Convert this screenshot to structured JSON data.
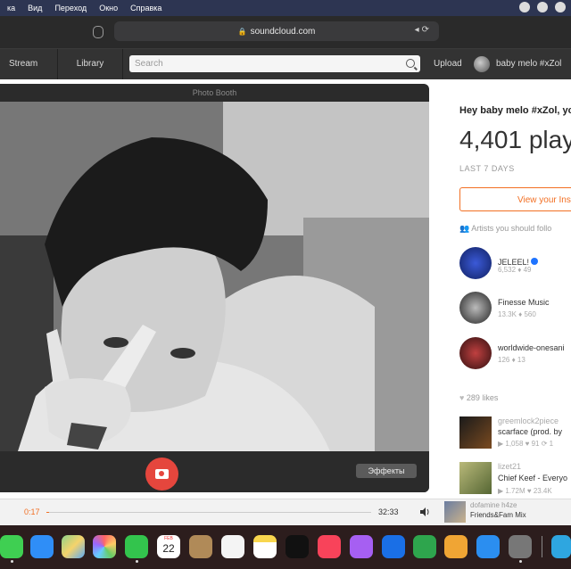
{
  "menubar": {
    "items": [
      "ка",
      "Вид",
      "Переход",
      "Окно",
      "Справка"
    ]
  },
  "browser": {
    "url": "soundcloud.com"
  },
  "soundcloud": {
    "nav": {
      "stream": "Stream",
      "library": "Library"
    },
    "search_placeholder": "Search",
    "upload": "Upload",
    "username": "baby melo #xZol"
  },
  "photo_booth": {
    "title": "Photo Booth",
    "effects_label": "Эффекты"
  },
  "sidebar": {
    "greeting": "Hey baby melo #xZol, yo",
    "plays": "4,401 play",
    "period": "LAST 7 DAYS",
    "insights_button": "View your Ins",
    "artists_title": "Artists you should follo",
    "artists": [
      {
        "name": "JELEEL!",
        "followers": "6,532",
        "tracks": "49",
        "verified": true
      },
      {
        "name": "Finesse Music",
        "followers": "13.3K",
        "tracks": "560",
        "verified": false
      },
      {
        "name": "worldwide-onesani",
        "followers": "126",
        "tracks": "13",
        "verified": false
      }
    ],
    "likes": "289 likes",
    "liked_tracks": [
      {
        "user": "greemlock2piece",
        "title": "scarface (prod. by",
        "plays": "1,058",
        "likes": "91",
        "reposts": "1"
      },
      {
        "user": "lizet21",
        "title": "Chief Keef - Everyo",
        "plays": "1.72M",
        "likes": "23.4K"
      }
    ]
  },
  "player": {
    "elapsed": "0:17",
    "duration": "32:33",
    "progress": 0.009,
    "now_playing_user": "dofamine h4ze",
    "now_playing_title": "Friends&Fam Mix"
  },
  "dock": {
    "calendar_month": "FEB",
    "calendar_day": "22",
    "apps": [
      "messages",
      "mail",
      "maps",
      "photos",
      "facetime",
      "calendar",
      "contacts",
      "reminders",
      "notes",
      "apple-tv",
      "music",
      "podcasts",
      "app-store-ios",
      "numbers",
      "keynote",
      "app-store",
      "system-preferences",
      "telegram"
    ]
  }
}
